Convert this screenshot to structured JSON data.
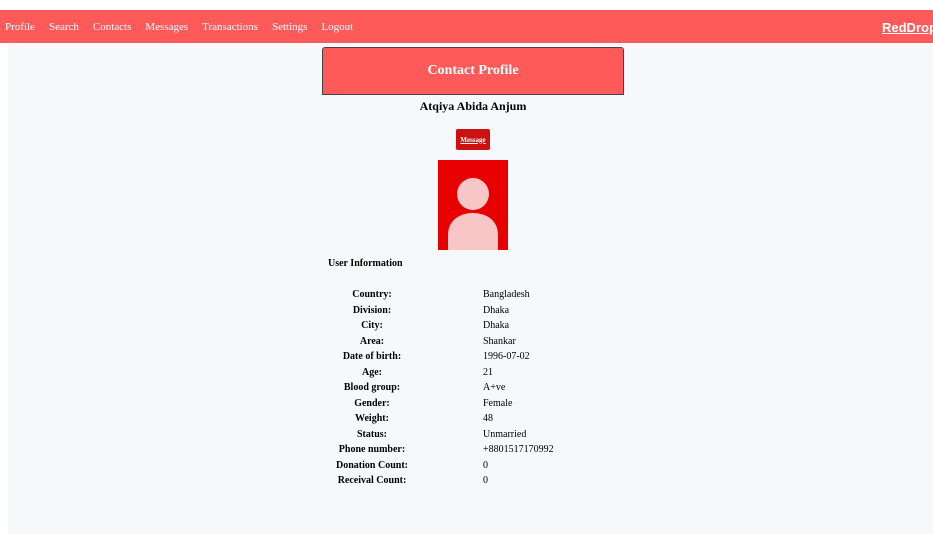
{
  "nav": {
    "items": [
      {
        "label": "Profile"
      },
      {
        "label": "Search"
      },
      {
        "label": "Contacts"
      },
      {
        "label": "Messages"
      },
      {
        "label": "Transactions"
      },
      {
        "label": "Settings"
      },
      {
        "label": "Logout"
      }
    ],
    "brand": "RedDrop",
    "brand_icon": "blood-drop-icon"
  },
  "colors": {
    "nav_bg": "#ff5a5a",
    "button_bg": "#cc1111",
    "avatar_bg": "#e60000",
    "avatar_figure": "#f7c6c6"
  },
  "profile": {
    "header_title": "Contact Profile",
    "name": "Atqiya Abida Anjum",
    "message_button": "Message",
    "avatar_icon": "user-avatar-icon"
  },
  "user_info": {
    "title": "User Information",
    "rows": [
      {
        "label": "Country:",
        "value": "Bangladesh"
      },
      {
        "label": "Division:",
        "value": "Dhaka"
      },
      {
        "label": "City:",
        "value": "Dhaka"
      },
      {
        "label": "Area:",
        "value": "Shankar"
      },
      {
        "label": "Date of birth:",
        "value": "1996-07-02"
      },
      {
        "label": "Age:",
        "value": "21"
      },
      {
        "label": "Blood group:",
        "value": "A+ve"
      },
      {
        "label": "Gender:",
        "value": "Female"
      },
      {
        "label": "Weight:",
        "value": "48"
      },
      {
        "label": "Status:",
        "value": "Unmarried"
      },
      {
        "label": "Phone number:",
        "value": "+8801517170992"
      },
      {
        "label": "Donation Count:",
        "value": "0"
      },
      {
        "label": "Receival Count:",
        "value": "0"
      }
    ]
  }
}
